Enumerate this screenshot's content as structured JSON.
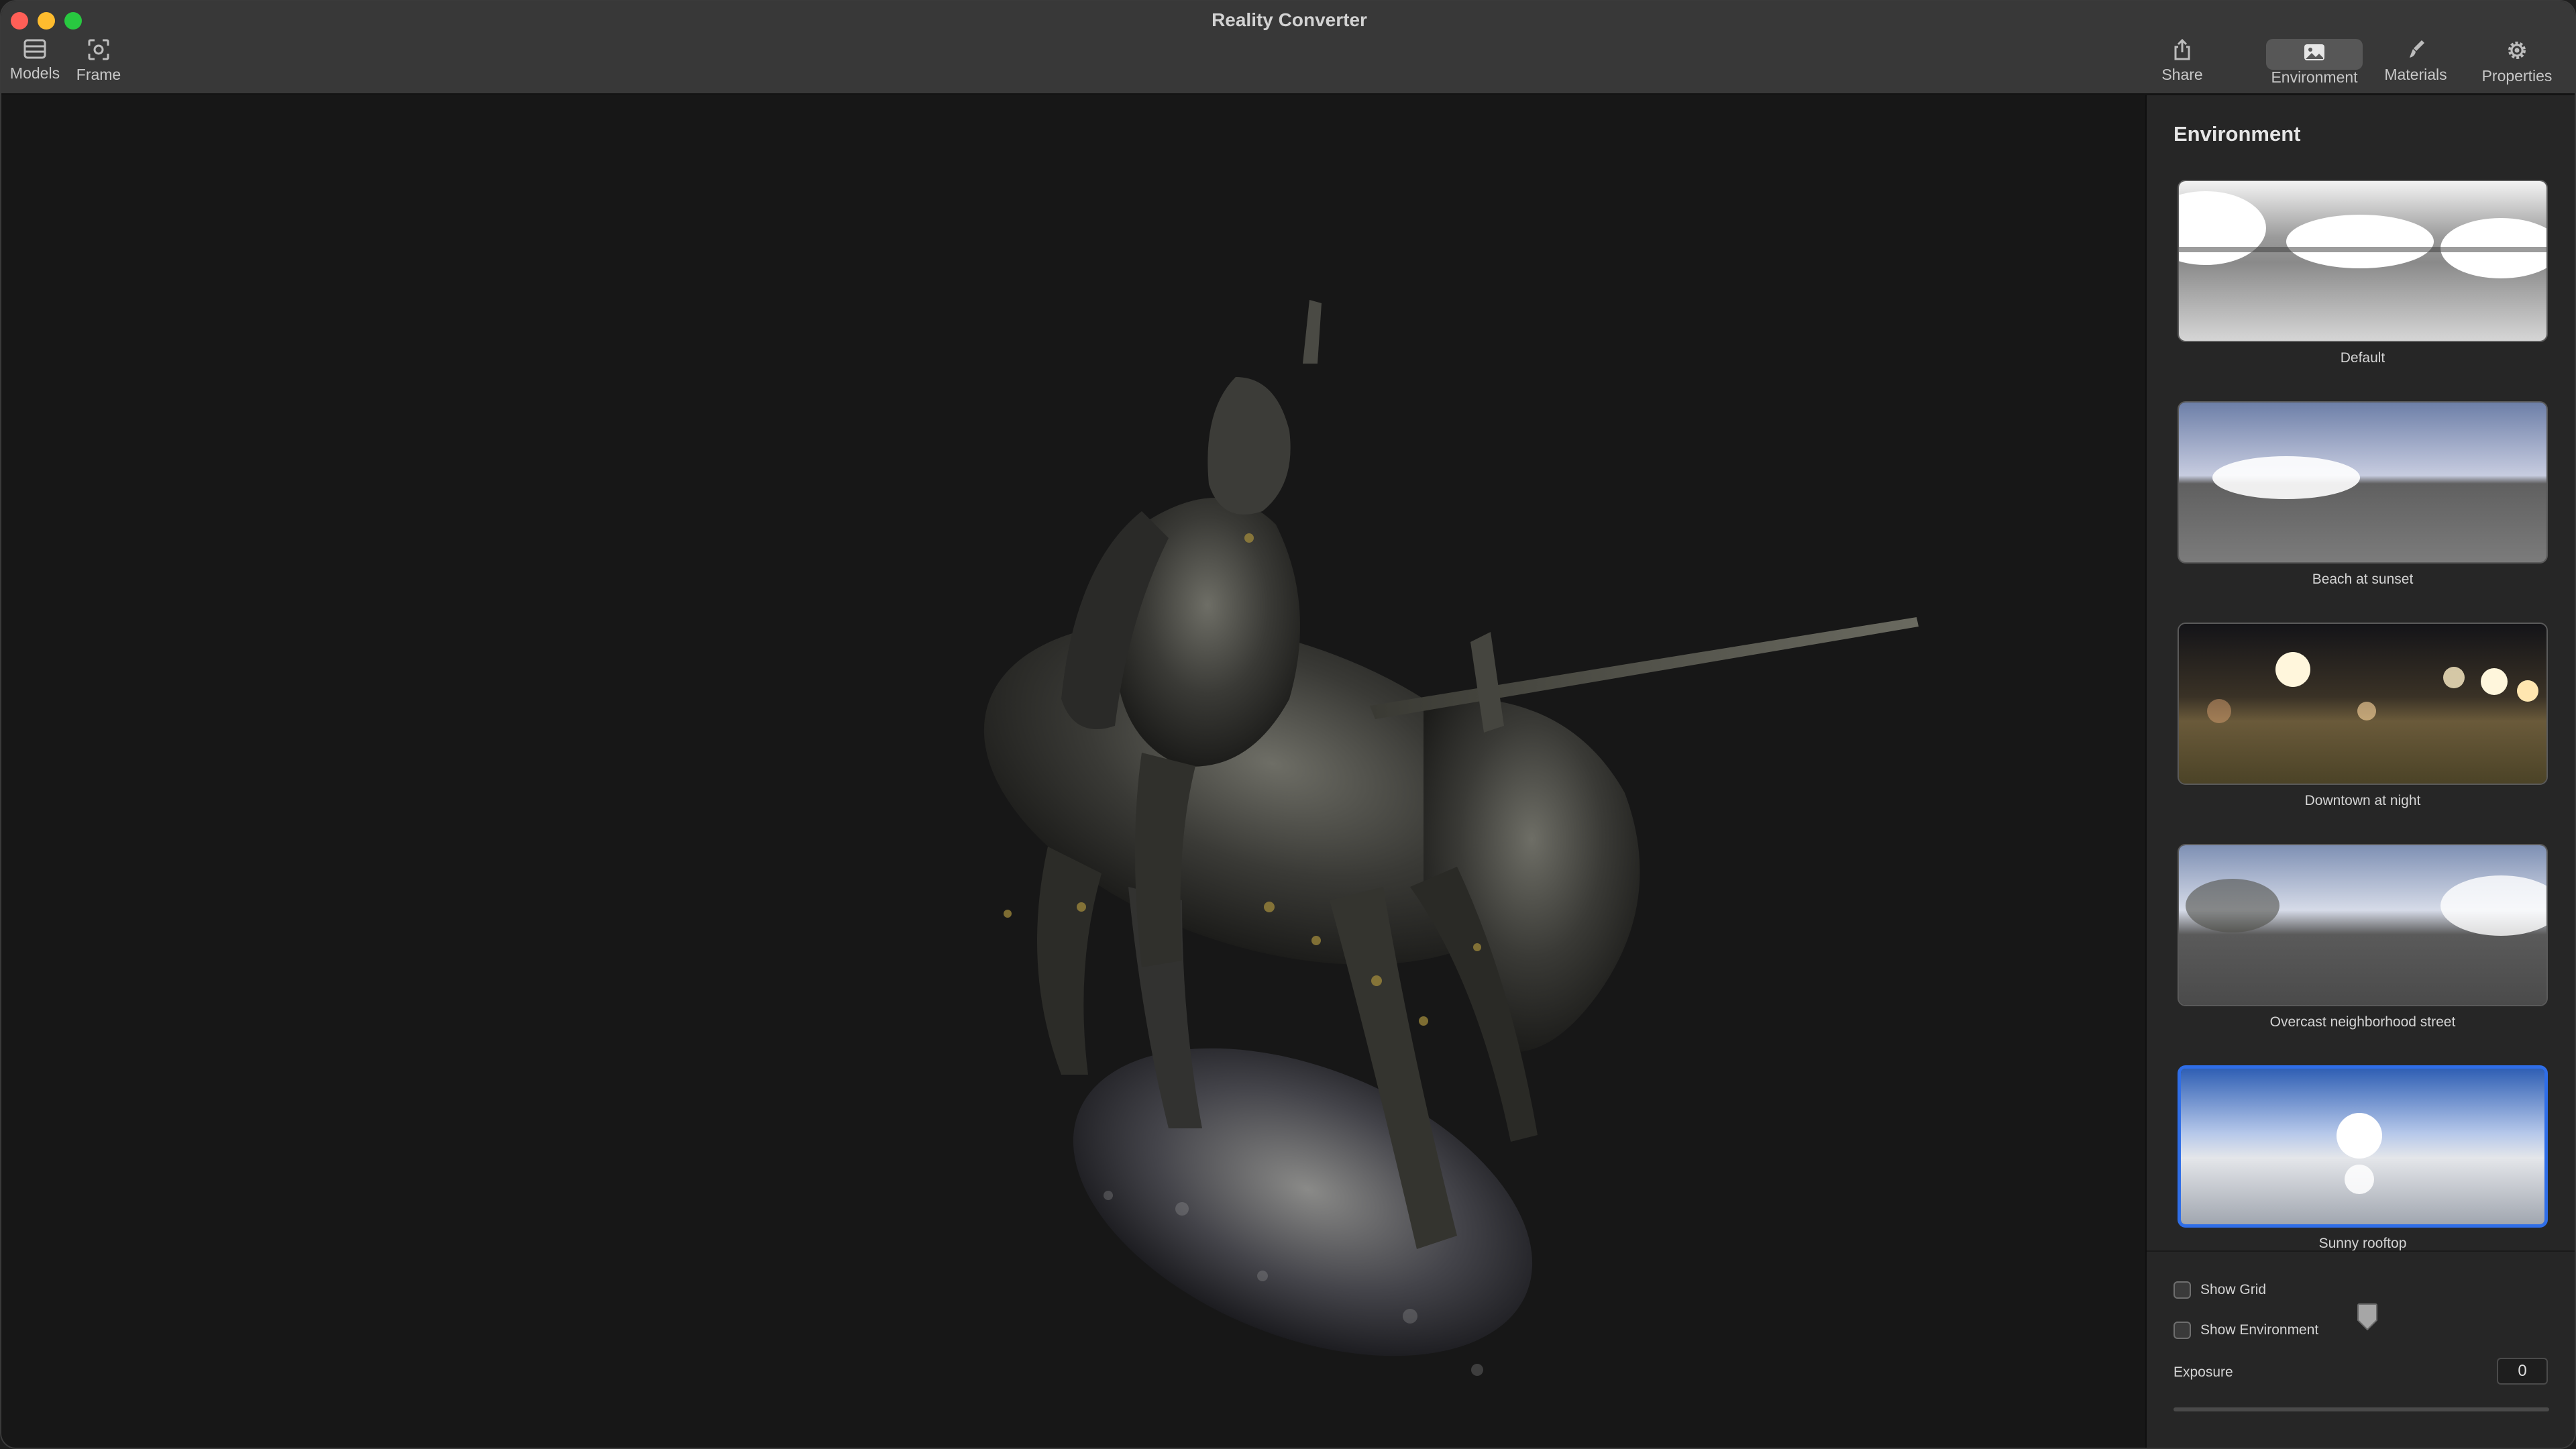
{
  "window": {
    "title": "Reality Converter"
  },
  "toolbar": {
    "models": "Models",
    "frame": "Frame",
    "share": "Share",
    "environment": "Environment",
    "materials": "Materials",
    "properties": "Properties"
  },
  "sidebar": {
    "title": "Environment",
    "environments": [
      {
        "label": "Default",
        "selected": false
      },
      {
        "label": "Beach at sunset",
        "selected": false
      },
      {
        "label": "Downtown at night",
        "selected": false
      },
      {
        "label": "Overcast neighborhood street",
        "selected": false
      },
      {
        "label": "Sunny rooftop",
        "selected": true
      }
    ],
    "show_grid": {
      "label": "Show Grid",
      "checked": false
    },
    "show_environment": {
      "label": "Show Environment",
      "checked": false
    },
    "exposure": {
      "label": "Exposure",
      "value": "0"
    }
  },
  "colors": {
    "accent": "#2f6ee8",
    "close": "#ff5f57",
    "minimize": "#febc2e",
    "maximize": "#28c840"
  }
}
